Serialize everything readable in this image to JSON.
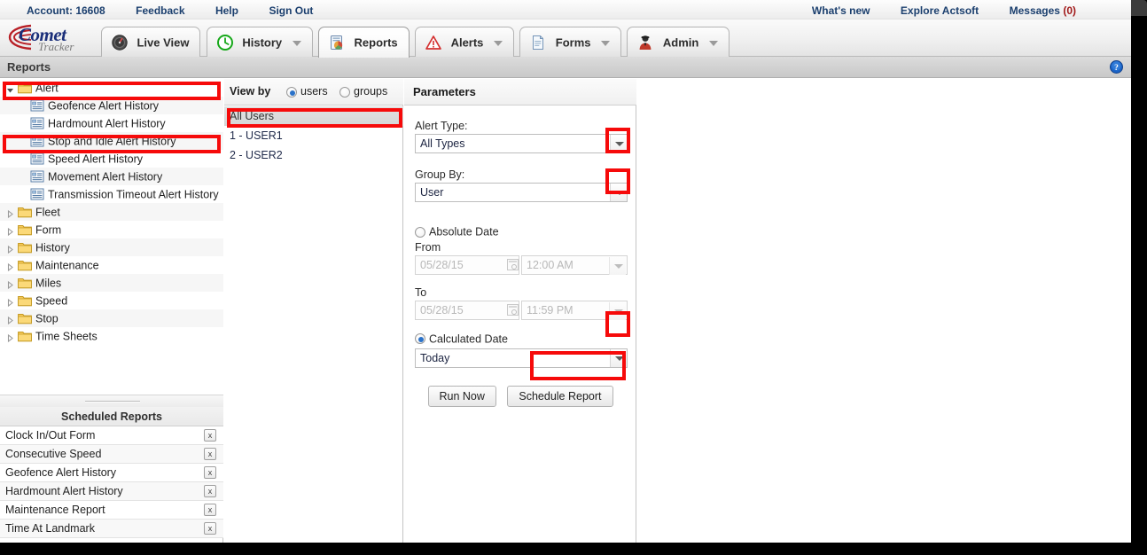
{
  "utility_bar": {
    "left_items": [
      {
        "label": "Account: 16608",
        "name": "account-link"
      },
      {
        "label": "Feedback",
        "name": "feedback-link"
      },
      {
        "label": "Help",
        "name": "help-link"
      },
      {
        "label": "Sign Out",
        "name": "sign-out-link"
      }
    ],
    "right_items": [
      {
        "label": "What's new",
        "name": "whats-new-link"
      },
      {
        "label": "Explore Actsoft",
        "name": "explore-actsoft-link"
      },
      {
        "label": "Messages",
        "count": "(0)",
        "name": "messages-link"
      }
    ]
  },
  "logo": {
    "primary": "Comet",
    "secondary": "Tracker"
  },
  "tabs": [
    {
      "label": "Live View",
      "icon": "gauge-icon",
      "has_caret": false,
      "active": false
    },
    {
      "label": "History",
      "icon": "clock-icon",
      "has_caret": true,
      "active": false
    },
    {
      "label": "Reports",
      "icon": "report-icon",
      "has_caret": false,
      "active": true
    },
    {
      "label": "Alerts",
      "icon": "warning-triangle-icon",
      "has_caret": true,
      "active": false
    },
    {
      "label": "Forms",
      "icon": "document-icon",
      "has_caret": true,
      "active": false
    },
    {
      "label": "Admin",
      "icon": "user-admin-icon",
      "has_caret": true,
      "active": false
    }
  ],
  "page_header": {
    "title": "Reports",
    "help_icon": "help-circle-icon"
  },
  "tree": {
    "nodes": [
      {
        "label": "Alert",
        "type": "folder",
        "level": 0,
        "expanded": true,
        "selected": true
      },
      {
        "label": "Geofence Alert History",
        "type": "report",
        "level": 1
      },
      {
        "label": "Hardmount Alert History",
        "type": "report",
        "level": 1
      },
      {
        "label": "Stop and Idle Alert History",
        "type": "report",
        "level": 1,
        "highlighted": true
      },
      {
        "label": "Speed Alert History",
        "type": "report",
        "level": 1
      },
      {
        "label": "Movement Alert History",
        "type": "report",
        "level": 1
      },
      {
        "label": "Transmission Timeout Alert History",
        "type": "report",
        "level": 1
      },
      {
        "label": "Fleet",
        "type": "folder",
        "level": 0,
        "expanded": false
      },
      {
        "label": "Form",
        "type": "folder",
        "level": 0,
        "expanded": false
      },
      {
        "label": "History",
        "type": "folder",
        "level": 0,
        "expanded": false
      },
      {
        "label": "Maintenance",
        "type": "folder",
        "level": 0,
        "expanded": false
      },
      {
        "label": "Miles",
        "type": "folder",
        "level": 0,
        "expanded": false
      },
      {
        "label": "Speed",
        "type": "folder",
        "level": 0,
        "expanded": false
      },
      {
        "label": "Stop",
        "type": "folder",
        "level": 0,
        "expanded": false
      },
      {
        "label": "Time Sheets",
        "type": "folder",
        "level": 0,
        "expanded": false
      }
    ]
  },
  "scheduled_reports": {
    "title": "Scheduled Reports",
    "delete_glyph": "x",
    "items": [
      {
        "name": "Clock In/Out Form"
      },
      {
        "name": "Consecutive Speed"
      },
      {
        "name": "Geofence Alert History"
      },
      {
        "name": "Hardmount Alert History"
      },
      {
        "name": "Maintenance Report"
      },
      {
        "name": "Time At Landmark"
      }
    ]
  },
  "view_by": {
    "label": "View by",
    "options": [
      {
        "label": "users",
        "selected": true
      },
      {
        "label": "groups",
        "selected": false
      }
    ],
    "list": [
      {
        "label": "All Users",
        "selected": true
      },
      {
        "label": "1 - USER1",
        "selected": false
      },
      {
        "label": "2 - USER2",
        "selected": false
      }
    ]
  },
  "parameters": {
    "title": "Parameters",
    "alert_type": {
      "label": "Alert Type:",
      "value": "All Types"
    },
    "group_by": {
      "label": "Group By:",
      "value": "User"
    },
    "absolute_date": {
      "label": "Absolute Date",
      "selected": false
    },
    "from": {
      "label": "From",
      "date": "05/28/15",
      "time": "12:00 AM"
    },
    "to": {
      "label": "To",
      "date": "05/28/15",
      "time": "11:59 PM"
    },
    "calculated_date": {
      "label": "Calculated Date",
      "selected": true,
      "value": "Today"
    },
    "buttons": [
      {
        "label": "Run Now",
        "name": "run-now-button"
      },
      {
        "label": "Schedule Report",
        "name": "schedule-report-button",
        "highlighted": true
      }
    ]
  },
  "annotations": {
    "color": "#f60a0a",
    "boxes": [
      {
        "target": "tree-node-alert"
      },
      {
        "target": "tree-node-stop-and-idle"
      },
      {
        "target": "all-users-row"
      },
      {
        "target": "alert-type-dropdown-arrow"
      },
      {
        "target": "group-by-dropdown-arrow"
      },
      {
        "target": "calculated-date-dropdown-arrow"
      },
      {
        "target": "schedule-report-button"
      }
    ]
  }
}
